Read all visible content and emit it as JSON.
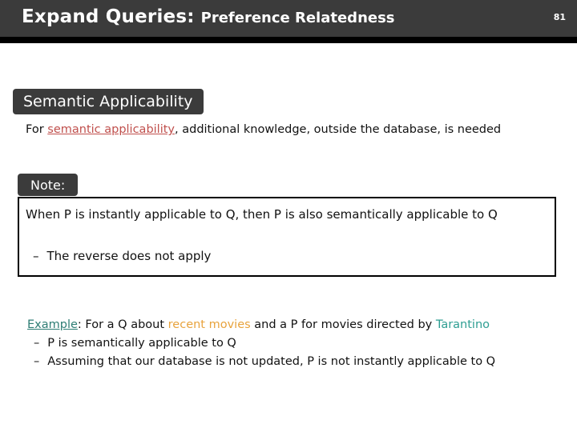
{
  "header": {
    "title_main": "Expand Queries:",
    "title_sub": "Preference Relatedness",
    "slide_number": "81"
  },
  "sections": {
    "semantic": {
      "chip_label": "Semantic Applicability",
      "text_before": "For ",
      "text_link": "semantic applicability",
      "text_after": ", additional knowledge, outside the database, is needed"
    },
    "note": {
      "chip_label": "Note:",
      "line1": "When P is instantly applicable to Q, then P is also semantically applicable to Q",
      "bullet_dash": "–",
      "bullet_text": "The reverse does not apply"
    },
    "example": {
      "label": "Example",
      "colon": ":",
      "lead_1": " For a Q about ",
      "highlight": "recent movies",
      "lead_2": " and a P for movies directed by ",
      "highlight2": "Tarantino",
      "bullets": [
        {
          "dash": "–",
          "text": "P is semantically applicable to Q"
        },
        {
          "dash": "–",
          "text": "Assuming that our database is not updated, P is not instantly applicable to Q"
        }
      ]
    }
  },
  "colors": {
    "header_bg": "#3b3b3b",
    "rule": "#000000",
    "link_red": "#c0504d",
    "teal": "#2e9e92",
    "orange": "#e8a33d"
  }
}
